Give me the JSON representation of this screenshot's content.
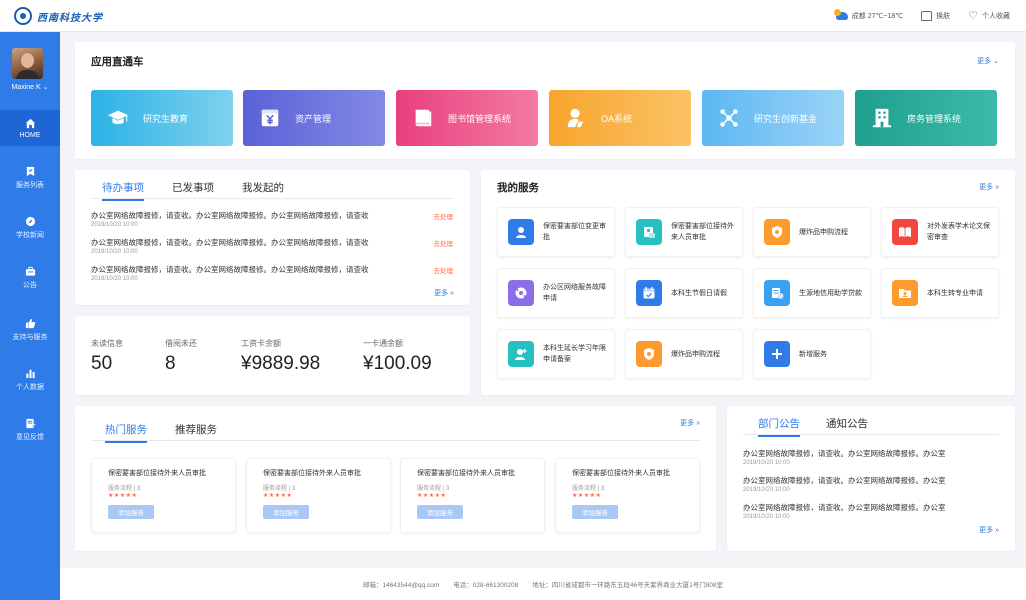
{
  "header": {
    "logo_text": "西南科技大学",
    "weather": "成都  27℃~18℃",
    "skin": "换肤",
    "favorites": "个人收藏"
  },
  "user": {
    "name": "Maxine K"
  },
  "sidebar": {
    "items": [
      {
        "label": "HOME",
        "icon": "home-icon",
        "active": true
      },
      {
        "label": "服务列表",
        "icon": "bookmark-icon"
      },
      {
        "label": "学校新闻",
        "icon": "compass-icon"
      },
      {
        "label": "公告",
        "icon": "briefcase-icon"
      },
      {
        "label": "支持与服务",
        "icon": "thumbs-up-icon"
      },
      {
        "label": "个人数据",
        "icon": "bar-chart-icon"
      },
      {
        "label": "意见反馈",
        "icon": "edit-icon"
      }
    ]
  },
  "apps": {
    "title": "应用直通车",
    "more": "更多",
    "items": [
      {
        "label": "研究生教育",
        "icon": "graduation-cap-icon"
      },
      {
        "label": "资产管理",
        "icon": "yen-box-icon"
      },
      {
        "label": "图书馆管理系统",
        "icon": "book-icon"
      },
      {
        "label": "OA系统",
        "icon": "person-icon"
      },
      {
        "label": "研究生创新基金",
        "icon": "network-icon"
      },
      {
        "label": "房务管理系统",
        "icon": "building-icon"
      }
    ]
  },
  "tasks": {
    "tabs": [
      "待办事项",
      "已发事项",
      "我发起的"
    ],
    "items": [
      {
        "text": "办公室网络故障报修，请查收。办公室网络故障报修。办公室网络故障报修，请查收",
        "date": "2019/10/20 10:00",
        "status": "去处理"
      },
      {
        "text": "办公室网络故障报修，请查收。办公室网络故障报修。办公室网络故障报修，请查收",
        "date": "2019/10/20 10:00",
        "status": "去处理"
      },
      {
        "text": "办公室网络故障报修，请查收。办公室网络故障报修。办公室网络故障报修，请查收",
        "date": "2019/10/20 10:00",
        "status": "去处理"
      }
    ],
    "more": "更多"
  },
  "stats": [
    {
      "label": "未读信息",
      "value": "50"
    },
    {
      "label": "借阅未还",
      "value": "8"
    },
    {
      "label": "工资卡余额",
      "value": "¥9889.98"
    },
    {
      "label": "一卡通余额",
      "value": "¥100.09"
    }
  ],
  "my_services": {
    "title": "我的服务",
    "more": "更多",
    "items": [
      {
        "label": "保密要害部位变更审批",
        "icon": "shield-user-icon",
        "color": "#2f7be8"
      },
      {
        "label": "保密要害部位接待外来人员审批",
        "icon": "user-lock-icon",
        "color": "#26c0c0"
      },
      {
        "label": "爆炸品申购流程",
        "icon": "shield-icon",
        "color": "#ff9a2e"
      },
      {
        "label": "对外发表学术论文保密审查",
        "icon": "book-open-icon",
        "color": "#f0483e"
      },
      {
        "label": "办公区网络服务故障申请",
        "icon": "globe-icon",
        "color": "#8c6de8"
      },
      {
        "label": "本科生节假日请假",
        "icon": "calendar-icon",
        "color": "#2f7be8"
      },
      {
        "label": "生源地信用助学贷款",
        "icon": "money-list-icon",
        "color": "#3aa0f0"
      },
      {
        "label": "本科生转专业申请",
        "icon": "folder-user-icon",
        "color": "#ff9a2e"
      },
      {
        "label": "本科生延长学习年限申请备案",
        "icon": "user-add-icon",
        "color": "#26c0c0"
      },
      {
        "label": "爆炸品申购流程",
        "icon": "shield-icon",
        "color": "#ff9a2e"
      },
      {
        "label": "新增服务",
        "icon": "plus-icon",
        "color": "#2f7be8"
      }
    ]
  },
  "hot": {
    "tabs": [
      "热门服务",
      "推荐服务"
    ],
    "more": "更多",
    "items": [
      {
        "title": "保密要害部位接待外来人员审批",
        "meta": "服务流程  |  3",
        "stars": "★★★★★",
        "button": "添加服务"
      },
      {
        "title": "保密要害部位接待外来人员审批",
        "meta": "服务流程  |  3",
        "stars": "★★★★★",
        "button": "添加服务"
      },
      {
        "title": "保密要害部位接待外来人员审批",
        "meta": "服务流程  |  3",
        "stars": "★★★★★",
        "button": "添加服务"
      },
      {
        "title": "保密要害部位接待外来人员审批",
        "meta": "服务流程  |  3",
        "stars": "★★★★★",
        "button": "添加服务"
      }
    ]
  },
  "notices": {
    "tabs": [
      "部门公告",
      "通知公告"
    ],
    "items": [
      {
        "text": "办公室网络故障报修，请查收。办公室网络故障报修。办公室",
        "date": "2019/10/20 10:00"
      },
      {
        "text": "办公室网络故障报修，请查收。办公室网络故障报修。办公室",
        "date": "2019/10/20 10:00"
      },
      {
        "text": "办公室网络故障报修，请查收。办公室网络故障报修。办公室",
        "date": "2019/10/20 10:00"
      }
    ],
    "more": "更多"
  },
  "footer": {
    "email": "邮箱：14643544@qq.com",
    "phone": "电话：028-661300208",
    "address": "地址：四川省成都市一环路东五段46号天紫界商业大厦1号门808室"
  }
}
